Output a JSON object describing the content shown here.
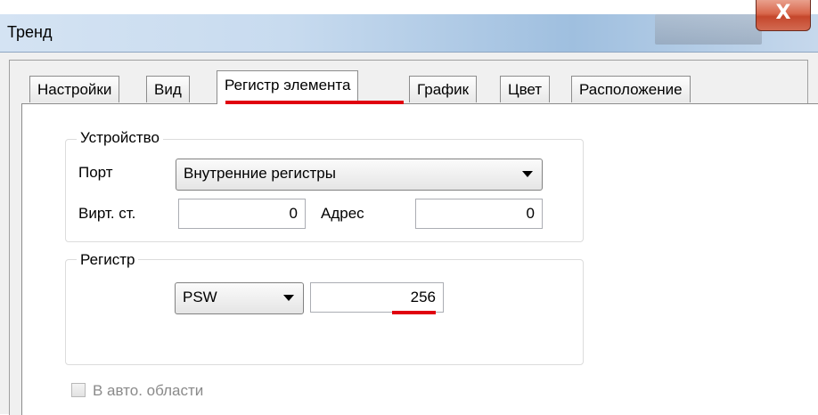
{
  "window": {
    "title": "Тренд",
    "close_glyph": "X"
  },
  "tabs": [
    {
      "label": "Настройки"
    },
    {
      "label": "Вид"
    },
    {
      "label": "Регистр элемента",
      "active": true
    },
    {
      "label": "График"
    },
    {
      "label": "Цвет"
    },
    {
      "label": "Расположение"
    }
  ],
  "device": {
    "group_label": "Устройство",
    "port_label": "Порт",
    "port_value": "Внутренние регистры",
    "virt_label": "Вирт. ст.",
    "virt_value": "0",
    "address_label": "Адрес",
    "address_value": "0"
  },
  "register": {
    "group_label": "Регистр",
    "type_value": "PSW",
    "number_value": "256"
  },
  "auto_area": {
    "label": "В авто. области",
    "checked": false,
    "enabled": false
  },
  "colors": {
    "highlight": "#e00010",
    "close_button": "#c5472c"
  }
}
